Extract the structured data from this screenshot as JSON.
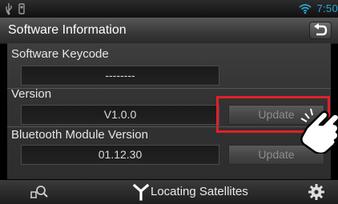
{
  "status_bar": {
    "usb_icon": "usb-icon",
    "phone_icon": "phone-icon",
    "wifi_icon": "wifi-icon",
    "time": "7:50"
  },
  "header": {
    "title": "Software Information",
    "back_icon": "back-icon"
  },
  "sections": {
    "keycode": {
      "label": "Software Keycode",
      "value": "--------"
    },
    "version": {
      "label": "Version",
      "value": "V1.0.0",
      "button": "Update"
    },
    "bluetooth": {
      "label": "Bluetooth Module Version",
      "value": "01.12.30",
      "button": "Update"
    }
  },
  "bottom_bar": {
    "left_icon": "search-icon",
    "gps_icon": "gps-antenna-icon",
    "gps_status": "Locating Satellites",
    "settings_icon": "gear-icon"
  },
  "colors": {
    "accent_time": "#2aa9d8",
    "highlight": "#e0202a"
  }
}
